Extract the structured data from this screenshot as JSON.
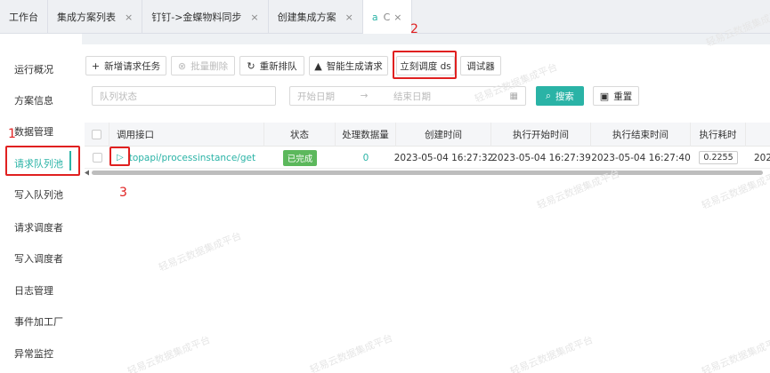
{
  "tabs": [
    {
      "label": "工作台",
      "closable": false
    },
    {
      "label": "集成方案列表",
      "closable": true
    },
    {
      "label": "钉钉->金蝶物料同步",
      "closable": true
    },
    {
      "label": "创建集成方案",
      "closable": true
    },
    {
      "label": "a",
      "extra": "C",
      "closable": true,
      "active": true
    }
  ],
  "sidebar": {
    "items": [
      {
        "label": "运行概况"
      },
      {
        "label": "方案信息"
      },
      {
        "label": "数据管理"
      },
      {
        "label": "请求队列池",
        "active": true
      },
      {
        "label": "写入队列池"
      },
      {
        "label": "请求调度者"
      },
      {
        "label": "写入调度者"
      },
      {
        "label": "日志管理"
      },
      {
        "label": "事件加工厂"
      },
      {
        "label": "异常监控"
      }
    ]
  },
  "toolbar": {
    "add_label": "新增请求任务",
    "batch_delete_label": "批量删除",
    "requeue_label": "重新排队",
    "smart_generate_label": "智能生成请求",
    "dispatch_now_label": "立刻调度 ds",
    "debugger_label": "调试器"
  },
  "filters": {
    "queue_status_placeholder": "队列状态",
    "start_date_placeholder": "开始日期",
    "end_date_placeholder": "结束日期",
    "search_label": "搜索",
    "reset_label": "重置"
  },
  "table": {
    "columns": [
      "调用接口",
      "状态",
      "处理数据量",
      "创建时间",
      "执行开始时间",
      "执行结束时间",
      "执行耗时"
    ],
    "rows": [
      {
        "api": "topapi/processinstance/get",
        "status": "已完成",
        "count": "0",
        "created": "2023-05-04 16:27:32",
        "started": "2023-05-04 16:27:39",
        "ended": "2023-05-04 16:27:40",
        "duration": "0.2255",
        "overflow": "202"
      }
    ]
  },
  "annotations": {
    "label1": "1",
    "label2": "2",
    "label3": "3"
  },
  "watermark": "轻易云数据集成平台",
  "colors": {
    "accent": "#2ab3a6",
    "annotation": "#e02020",
    "success": "#5cb85c"
  }
}
